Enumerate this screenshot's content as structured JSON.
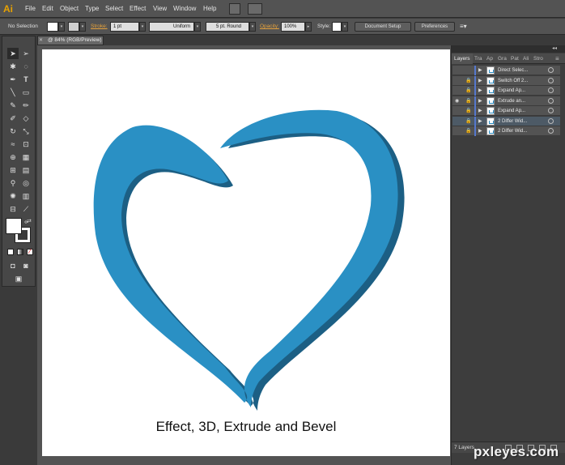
{
  "app": {
    "logo": "Ai"
  },
  "menu": [
    "File",
    "Edit",
    "Object",
    "Type",
    "Select",
    "Effect",
    "View",
    "Window",
    "Help"
  ],
  "control_bar": {
    "selection": "No Selection",
    "stroke_label": "Stroke:",
    "stroke_value": "1 pt",
    "profile": "Uniform",
    "brush": "5 pt. Round",
    "opacity_label": "Opacity:",
    "opacity_value": "100%",
    "style_label": "Style:",
    "document_setup": "Document Setup",
    "preferences": "Preferences"
  },
  "document": {
    "tab_title": "@ 84% (RGB/Preview)"
  },
  "artwork": {
    "caption": "Effect, 3D, Extrude and Bevel",
    "heart_color": "#2a90c4",
    "extrude_color": "#1c5f84"
  },
  "layers_panel": {
    "tabs": [
      "Layers",
      "Tra",
      "Ap",
      "Gra",
      "Pat",
      "Ali",
      "Stro"
    ],
    "layers": [
      {
        "name": "Direct Selec...",
        "visible": false,
        "locked": false
      },
      {
        "name": "Switch Off 2...",
        "visible": false,
        "locked": true
      },
      {
        "name": "Expand Ap...",
        "visible": false,
        "locked": true
      },
      {
        "name": "Extrude an...",
        "visible": true,
        "locked": true
      },
      {
        "name": "Expand Ap...",
        "visible": false,
        "locked": true
      },
      {
        "name": "2 Differ Wid...",
        "visible": false,
        "locked": true
      },
      {
        "name": "2 Differ Wid...",
        "visible": false,
        "locked": true
      }
    ],
    "footer_count": "7 Layers"
  },
  "watermark": "pxleyes.com"
}
